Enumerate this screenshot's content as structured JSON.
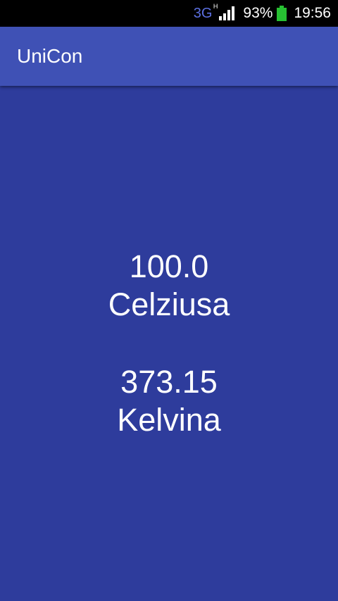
{
  "status_bar": {
    "network_type": "3G",
    "network_sub": "H",
    "battery_percent": "93%",
    "time": "19:56",
    "battery_color": "#27c132"
  },
  "app_bar": {
    "title": "UniCon",
    "color": "#3f51b5"
  },
  "main": {
    "background": "#2e3c9c",
    "source": {
      "value": "100.0",
      "unit": "Celziusa"
    },
    "result": {
      "value": "373.15",
      "unit": "Kelvina"
    }
  }
}
